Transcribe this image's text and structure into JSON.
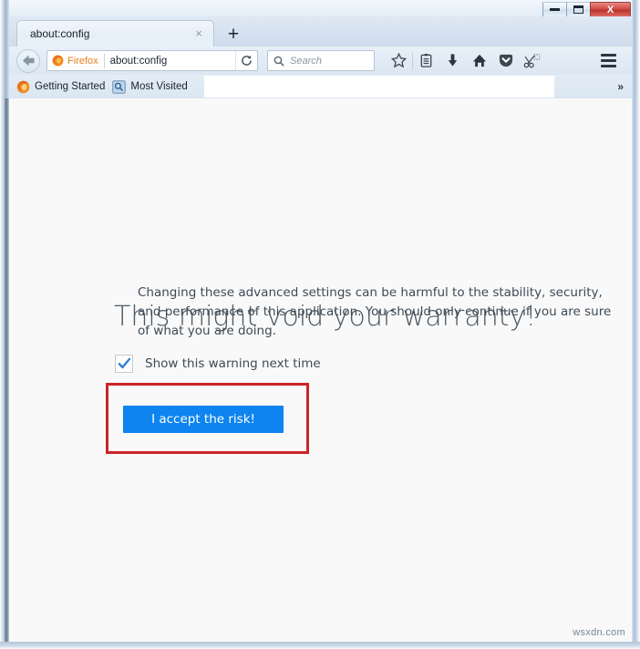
{
  "window": {
    "titlebar": {
      "minimize_label": "Minimize",
      "maximize_label": "Maximize",
      "close_label": "X"
    }
  },
  "tabs": [
    {
      "title": "about:config",
      "close_label": "×",
      "active": true
    }
  ],
  "newtab": {
    "label": "+"
  },
  "navbar": {
    "back_label": "Back",
    "identity_label": "Firefox",
    "url_value": "about:config",
    "reload_label": "⟳",
    "search": {
      "placeholder": "Search",
      "value": ""
    },
    "icons": [
      {
        "name": "bookmark-star-icon",
        "label": "Bookmark this page"
      },
      {
        "name": "reading-list-icon",
        "label": "Show your bookmarks"
      },
      {
        "name": "download-arrow-icon",
        "label": "Downloads"
      },
      {
        "name": "home-icon",
        "label": "Home"
      },
      {
        "name": "pocket-icon",
        "label": "Save to Pocket"
      },
      {
        "name": "clip-scissors-icon",
        "label": "Clip"
      }
    ],
    "menu_label": "Open menu"
  },
  "bookmarks": {
    "items": [
      {
        "label": "Getting Started",
        "icon": "firefox-icon"
      },
      {
        "label": "Most Visited",
        "icon": "most-visited-icon"
      }
    ],
    "overflow_label": "»"
  },
  "page": {
    "title": "This might void your warranty!",
    "body": "Changing these advanced settings can be harmful to the stability, security, and performance of this application. You should only continue if you are sure of what you are doing.",
    "checkbox": {
      "label": "Show this warning next time",
      "checked": true,
      "check_glyph": "✓"
    },
    "accept_button_label": "I accept the risk!"
  },
  "annotation": {
    "shape": "rectangle",
    "color": "#cc2229",
    "targets": "accept-risk-button"
  },
  "watermark": {
    "text": "wsxdn.com"
  },
  "colors": {
    "accent_blue": "#0d84ef",
    "annotation_red": "#cc2229",
    "checkmark_blue": "#2a7fd4",
    "firefox_orange": "#e2811c",
    "page_background": "#f9f9f9",
    "heading_gray": "#4d5963",
    "body_gray": "#3e4a55",
    "chrome_blue": "#dce7f2"
  }
}
